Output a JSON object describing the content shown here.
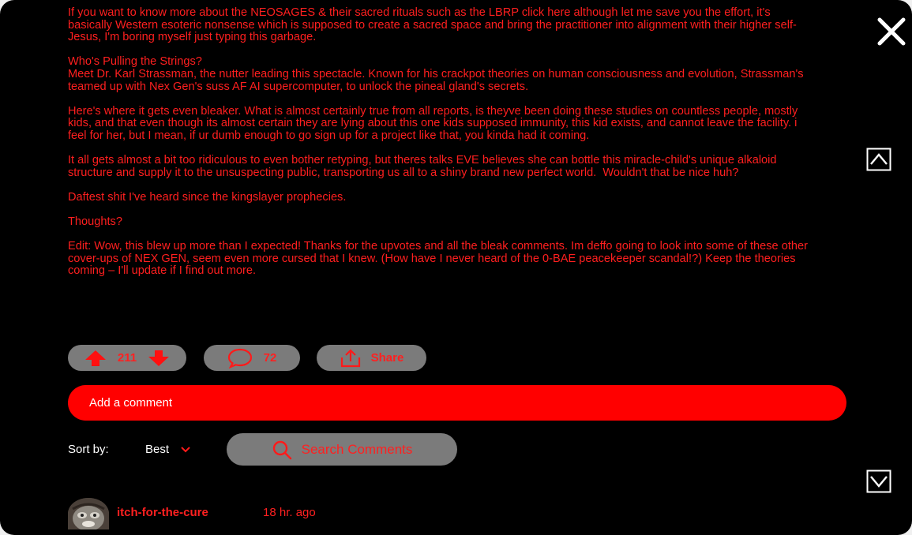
{
  "post": {
    "paragraphs": [
      "If you want to know more about the NEOSAGES & their sacred rituals such as the LBRP click here although let me save you the effort, it's basically Western esoteric nonsense which is supposed to create a sacred space and bring the practitioner into alignment with their higher self- Jesus, I'm boring myself just typing this garbage.",
      "Who's Pulling the Strings?\nMeet Dr. Karl Strassman, the nutter leading this spectacle. Known for his crackpot theories on human consciousness and evolution, Strassman's teamed up with Nex Gen's suss AF AI supercomputer, to unlock the pineal gland's secrets.",
      "Here's where it gets even bleaker. What is almost certainly true from all reports, is theyve been doing these studies on countless people, mostly kids, and that even though its almost certain they are lying about this one kids supposed immunity, this kid exists, and cannot leave the facility. i feel for her, but I mean, if ur dumb enough to go sign up for a project like that, you kinda had it coming.",
      "It all gets almost a bit too ridiculous to even bother retyping, but theres talks EVE believes she can bottle this miracle-child's unique alkaloid structure and supply it to the unsuspecting public, transporting us all to a shiny brand new perfect world.  Wouldn't that be nice huh?",
      "Daftest shit I've heard since the kingslayer prophecies.",
      "Thoughts?",
      "Edit: Wow, this blew up more than I expected! Thanks for the upvotes and all the bleak comments. Im deffo going to look into some of these other cover-ups of NEX GEN, seem even more cursed that I knew. (How have I never heard of the 0-BAE peacekeeper scandal!?) Keep the theories coming – I'll update if I find out more."
    ]
  },
  "actions": {
    "vote_count": "211",
    "comment_count": "72",
    "share_label": "Share"
  },
  "add_comment": {
    "placeholder": "Add a comment"
  },
  "sort": {
    "label": "Sort by:",
    "selected": "Best"
  },
  "search": {
    "label": "Search Comments"
  },
  "comment": {
    "username": "itch-for-the-cure",
    "timestamp": "18 hr. ago"
  },
  "icons": {
    "close": "close-icon",
    "scroll_up": "chevron-up-icon",
    "scroll_down": "chevron-down-icon",
    "upvote": "upvote-arrow-icon",
    "downvote": "downvote-arrow-icon",
    "comment": "speech-bubble-icon",
    "share": "share-icon",
    "search": "search-icon",
    "sort_caret": "chevron-down-icon"
  },
  "colors": {
    "background": "#000000",
    "text_red": "#ff1f1f",
    "accent_red": "#ff0000",
    "pill_gray": "#7b7b7b",
    "white": "#ffffff"
  }
}
